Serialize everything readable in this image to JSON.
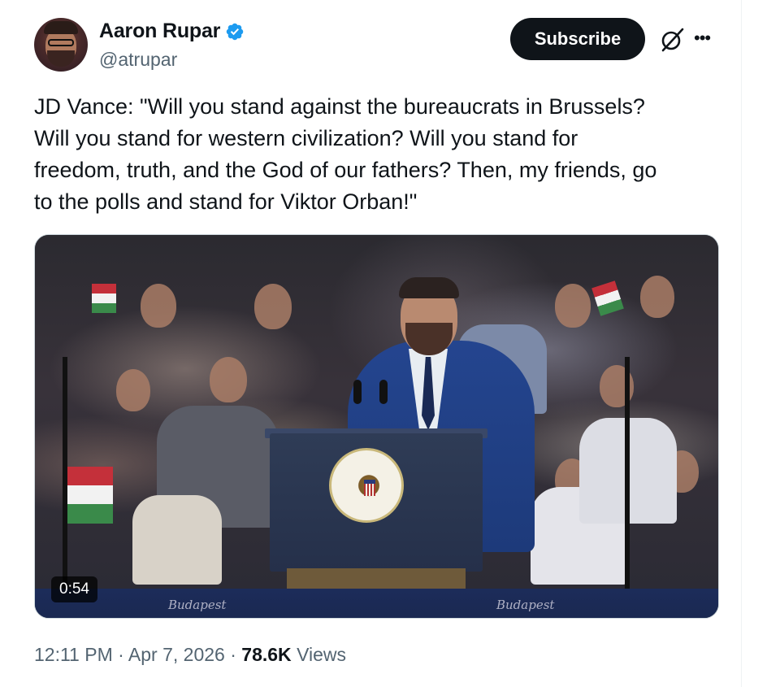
{
  "author": {
    "display_name": "Aaron Rupar",
    "handle": "@atrupar",
    "verified": true,
    "verified_color": "#1d9bf0"
  },
  "actions": {
    "subscribe_label": "Subscribe",
    "grok_icon": "grok-icon",
    "more_icon": "more-icon",
    "more_glyph": "•••"
  },
  "tweet": {
    "text": "JD Vance: \"Will you stand against the bureaucrats in Brussels?\nWill you stand for western civilization? Will you stand for\nfreedom, truth, and the God of our fathers? Then, my friends, go\nto the polls and stand for Viktor Orban!\""
  },
  "media": {
    "duration": "0:54",
    "banner_left": "Budapest",
    "banner_right": "Budapest"
  },
  "meta": {
    "time": "12:11 PM",
    "separator": " · ",
    "date": "Apr 7, 2026",
    "views_count": "78.6K",
    "views_label": "Views"
  }
}
